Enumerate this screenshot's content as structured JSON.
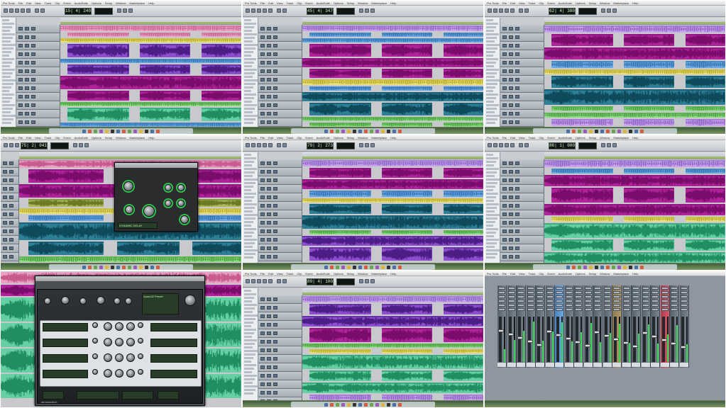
{
  "app": {
    "menu": [
      "Pro Tools",
      "File",
      "Edit",
      "View",
      "Track",
      "Clip",
      "Event",
      "AudioSuite",
      "Options",
      "Setup",
      "Window",
      "Marketplace",
      "Help"
    ]
  },
  "colors": {
    "pink": "#e8a3c4",
    "magenta": "#b0239b",
    "purple": "#8d4fd0",
    "blue": "#6aa8e0",
    "teal": "#2d7f96",
    "green": "#8fda84",
    "mint": "#66cfa4",
    "yellow": "#e8e07a",
    "olive": "#aab85c",
    "lavender": "#c9a4ec",
    "counter_text": "#d8f7cf",
    "meter_green": "#34d54e"
  },
  "panes": [
    {
      "id": "p1",
      "counter": "15| 4| 240",
      "tracks": [
        "pink",
        "pink",
        "yellow",
        "purple",
        "blue",
        "purple",
        "magenta",
        "magenta",
        "green",
        "mint",
        "blue"
      ]
    },
    {
      "id": "p2",
      "counter": "45| 4| 347",
      "tracks": [
        "lavender",
        "blue",
        "blue",
        "magenta",
        "magenta",
        "magenta",
        "yellow",
        "blue",
        "teal",
        "teal",
        "green",
        "green"
      ]
    },
    {
      "id": "p3",
      "counter": "62| 4| 380",
      "tracks": [
        "lavender",
        "magenta",
        "magenta",
        "blue",
        "yellow",
        "teal",
        "teal",
        "green",
        "green",
        "lavender"
      ]
    },
    {
      "id": "p4",
      "counter": "75| 2| 041",
      "tracks": [
        "pink",
        "magenta",
        "magenta",
        "olive",
        "yellow",
        "blue",
        "teal",
        "teal",
        "green"
      ],
      "plugin": {
        "title": "DYNAMIC DELAY"
      }
    },
    {
      "id": "p5",
      "counter": "79| 2| 273",
      "tracks": [
        "lavender",
        "magenta",
        "magenta",
        "blue",
        "yellow",
        "teal",
        "teal",
        "green",
        "purple",
        "purple"
      ]
    },
    {
      "id": "p6",
      "counter": "86| 1| 000",
      "tracks": [
        "lavender",
        "blue",
        "magenta",
        "magenta",
        "magenta",
        "yellow",
        "mint",
        "mint",
        "mint"
      ]
    },
    {
      "id": "p7",
      "plugin": {
        "title": "Xpand!2",
        "lcd": "Xpand!2 Preset",
        "brand": "airmusictech"
      }
    },
    {
      "id": "p8",
      "counter": "89| 4| 100",
      "tracks": [
        "lavender",
        "purple",
        "purple",
        "magenta",
        "green",
        "yellow",
        "mint",
        "mint",
        "mint",
        "lavender"
      ]
    },
    {
      "id": "p9",
      "mixer": {
        "strips": 20,
        "highlights": [
          6,
          12,
          17
        ]
      }
    }
  ]
}
